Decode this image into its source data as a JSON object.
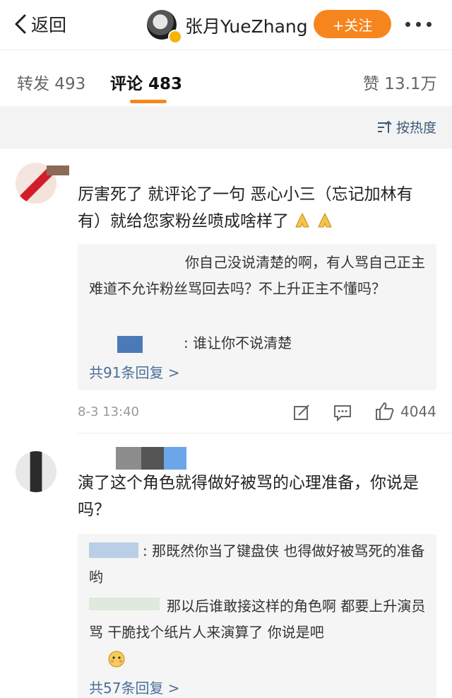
{
  "header": {
    "back_label": "返回",
    "user_name": "张月YueZhang",
    "follow_label": "+关注",
    "colors": {
      "accent": "#f7851d",
      "verified": "#f6b400"
    }
  },
  "tabs": {
    "repost_label": "转发 493",
    "comment_label": "评论 483",
    "like_label": "赞 13.1万"
  },
  "sort": {
    "label": "按热度"
  },
  "comments": [
    {
      "text": "厉害死了 就评论了一句 恶心小三（忘记加林有有）就给您家粉丝喷成啥样了",
      "emojis": [
        "pray-emoji",
        "pray-emoji"
      ],
      "replies": [
        {
          "text": "你自己没说清楚的啊，有人骂自己正主难道不允许粉丝骂回去吗？不上升正主不懂吗？"
        },
        {
          "text": ": 谁让你不说清楚"
        }
      ],
      "reply_count": "共91条回复 >",
      "time": "8-3 13:40",
      "likes": "4044"
    },
    {
      "text": "演了这个角色就得做好被骂的心理准备，你说是吗？",
      "replies": [
        {
          "text": ": 那既然你当了键盘侠 也得做好被骂死的准备哟"
        },
        {
          "text": "那以后谁敢接这样的角色啊 都要上升演员骂 干脆找个纸片人来演算了 你说是吧"
        }
      ],
      "reply_count": "共57条回复 >"
    }
  ]
}
